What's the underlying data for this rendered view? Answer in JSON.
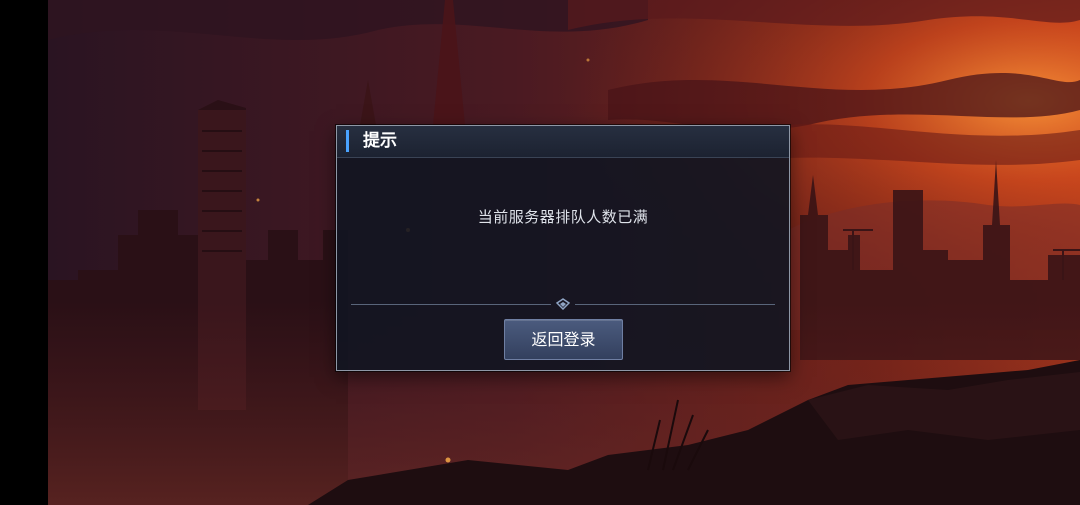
{
  "dialog": {
    "title": "提示",
    "message": "当前服务器排队人数已满",
    "return_button_label": "返回登录"
  },
  "colors": {
    "accent": "#4aa3ff",
    "dialog_background": "#111521",
    "button_background": "#3f4d6e",
    "sky_glow": "#e8582a"
  }
}
